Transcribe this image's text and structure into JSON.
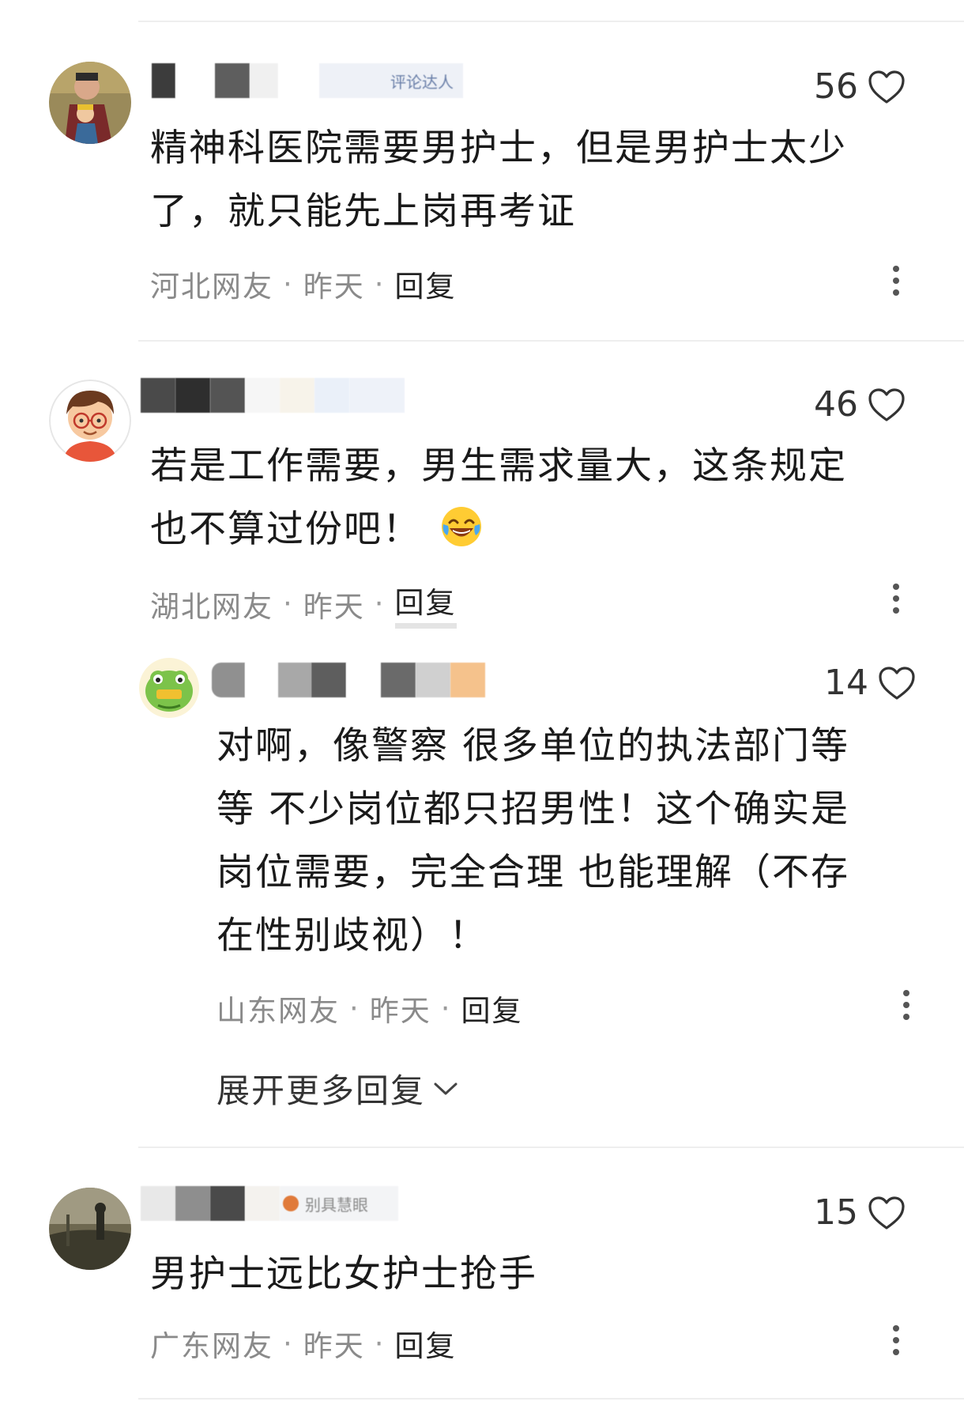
{
  "comments": [
    {
      "likes": "56",
      "text_lines": [
        "精神科医院需要男护士，但是男护士太少",
        "了，就只能先上岗再考证"
      ],
      "location": "河北网友",
      "time": "昨天",
      "reply_label": "回复",
      "badge_text": "评论达人"
    },
    {
      "likes": "46",
      "text_lines": [
        "若是工作需要，男生需求量大，这条规定",
        "也不算过份吧！"
      ],
      "location": "湖北网友",
      "time": "昨天",
      "reply_label": "回复",
      "emoji": "laughing-tears-emoji"
    },
    {
      "likes": "14",
      "text_lines": [
        "对啊，像警察 很多单位的执法部门等",
        "等 不少岗位都只招男性！这个确实是",
        "岗位需要，完全合理 也能理解（不存",
        "在性别歧视）！"
      ],
      "location": "山东网友",
      "time": "昨天",
      "reply_label": "回复"
    },
    {
      "likes": "15",
      "text_lines": [
        "男护士远比女护士抢手"
      ],
      "location": "广东网友",
      "time": "昨天",
      "reply_label": "回复",
      "badge_text": "别具慧眼"
    }
  ],
  "expand_replies_label": "展开更多回复",
  "separator": "·",
  "icons": {
    "like": "heart-outline-icon",
    "more": "more-vertical-icon",
    "expand": "chevron-down-icon"
  }
}
